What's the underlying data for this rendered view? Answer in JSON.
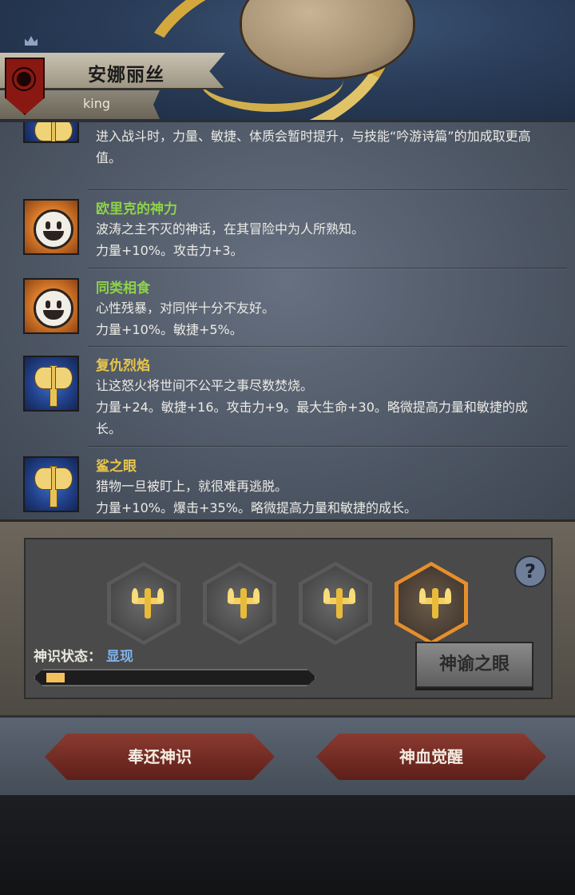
{
  "hero": {
    "name": "安娜丽丝",
    "title": "king"
  },
  "partial_trait": {
    "desc": "进入战斗时，力量、敏捷、体质会暂时提升，与技能“吟游诗篇”的加成取更高值。"
  },
  "traits": [
    {
      "name": "欧里克的神力",
      "name_color": "green",
      "icon": "smile-face-icon",
      "desc": "波涛之主不灭的神话，在其冒险中为人所熟知。",
      "effect": "力量+10%。攻击力+3。"
    },
    {
      "name": "同类相食",
      "name_color": "green",
      "icon": "smile-face-icon",
      "desc": "心性残暴，对同伴十分不友好。",
      "effect": "力量+10%。敏捷+5%。"
    },
    {
      "name": "复仇烈焰",
      "name_color": "yellow",
      "icon": "axe-icon",
      "desc": "让这怒火将世间不公平之事尽数焚烧。",
      "effect": "力量+24。敏捷+16。攻击力+9。最大生命+30。略微提高力量和敏捷的成长。"
    },
    {
      "name": "鲨之眼",
      "name_color": "yellow",
      "icon": "axe-icon",
      "desc": "猎物一旦被盯上，就很难再逃脱。",
      "effect": "力量+10%。爆击+35%。略微提高力量和敏捷的成长。"
    }
  ],
  "awakening": {
    "slots": [
      {
        "icon": "trident-icon",
        "active": false
      },
      {
        "icon": "trident-icon",
        "active": false
      },
      {
        "icon": "trident-icon",
        "active": false
      },
      {
        "icon": "trident-icon",
        "active": true
      }
    ],
    "help_label": "?",
    "status_label": "神识状态：",
    "status_value": "显现",
    "progress": 0.07,
    "oracle_button": "神谕之眼"
  },
  "actions": {
    "return_label": "奉还神识",
    "awaken_label": "神血觉醒"
  },
  "colors": {
    "green_name": "#8ed24a",
    "yellow_name": "#e8c64b",
    "status_value": "#7fb2ea",
    "progress_fill": "#f2c15b",
    "active_slot": "#e58f2c"
  }
}
